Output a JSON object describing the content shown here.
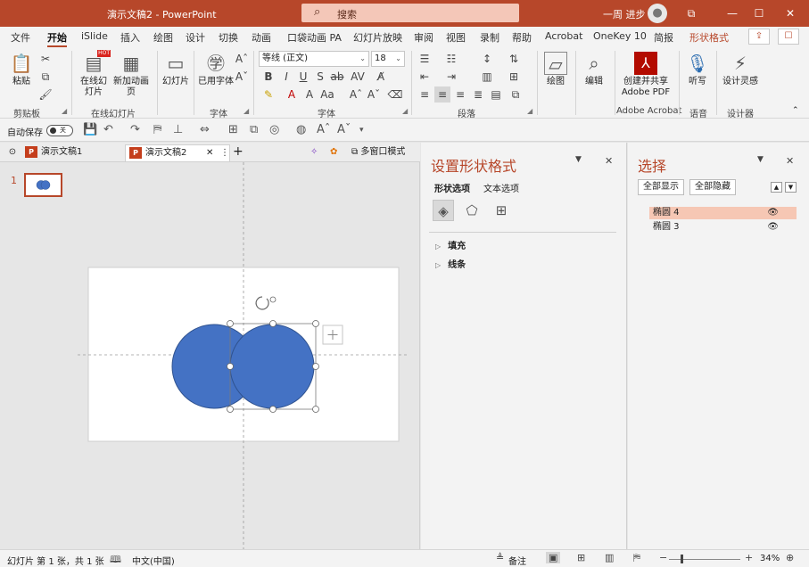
{
  "window": {
    "title": "演示文稿2 - PowerPoint",
    "search_placeholder": "搜索",
    "user_name": "一周 进步",
    "controls": {
      "restore_ribbon": "⧉",
      "minimize": "—",
      "maximize": "☐",
      "close": "✕"
    }
  },
  "ribbon_tabs": [
    {
      "label": "文件"
    },
    {
      "label": "开始"
    },
    {
      "label": "iSlide"
    },
    {
      "label": "插入"
    },
    {
      "label": "绘图"
    },
    {
      "label": "设计"
    },
    {
      "label": "切换"
    },
    {
      "label": "动画"
    },
    {
      "label": "口袋动画 PA"
    },
    {
      "label": "幻灯片放映"
    },
    {
      "label": "审阅"
    },
    {
      "label": "视图"
    },
    {
      "label": "录制"
    },
    {
      "label": "帮助"
    },
    {
      "label": "Acrobat"
    },
    {
      "label": "OneKey 10"
    },
    {
      "label": "简报"
    },
    {
      "label": "形状格式"
    }
  ],
  "ribbon": {
    "clipboard": {
      "paste": "粘贴",
      "group": "剪贴板"
    },
    "online_slides": {
      "online": "在线幻灯片",
      "new_anim": "新加动画页",
      "group": "在线幻灯片",
      "hot": "HOT"
    },
    "slides": {
      "slides": "幻灯片"
    },
    "fonts": {
      "used_fonts": "已用字体",
      "group": "字体",
      "font_name": "等线 (正文)",
      "font_size": "18"
    },
    "paragraph": {
      "group": "段落"
    },
    "drawing": {
      "draw": "绘图",
      "edit": "编辑"
    },
    "adobe": {
      "create_share": "创建并共享 Adobe PDF",
      "group": "Adobe Acrobat"
    },
    "voice": {
      "dictate": "听写",
      "group": "语音"
    },
    "designer": {
      "design_ideas": "设计灵感",
      "group": "设计器"
    }
  },
  "quick_access": {
    "autosave": "自动保存",
    "toggle_state": "关"
  },
  "doc_tabs": {
    "tabs": [
      {
        "label": "演示文稿1"
      },
      {
        "label": "演示文稿2"
      }
    ],
    "new_tab": "+",
    "multi_window": "多窗口模式"
  },
  "thumbnails": {
    "slide_number": "1"
  },
  "format_pane": {
    "title": "设置形状格式",
    "subtabs": [
      "形状选项",
      "文本选项"
    ],
    "sections": [
      "填充",
      "线条"
    ]
  },
  "selection_pane": {
    "title": "选择",
    "show_all": "全部显示",
    "hide_all": "全部隐藏",
    "items": [
      {
        "label": "椭圆 4",
        "selected": true
      },
      {
        "label": "椭圆 3",
        "selected": false
      }
    ]
  },
  "status_bar": {
    "slide_info": "幻灯片 第 1 张，共 1 张",
    "language": "中文(中国)",
    "notes": "备注",
    "zoom": "34%"
  },
  "colors": {
    "accent": "#b7472a",
    "shape_fill": "#4472c4",
    "shape_outline": "#2f528f",
    "selected_item": "#f6c7b4"
  }
}
